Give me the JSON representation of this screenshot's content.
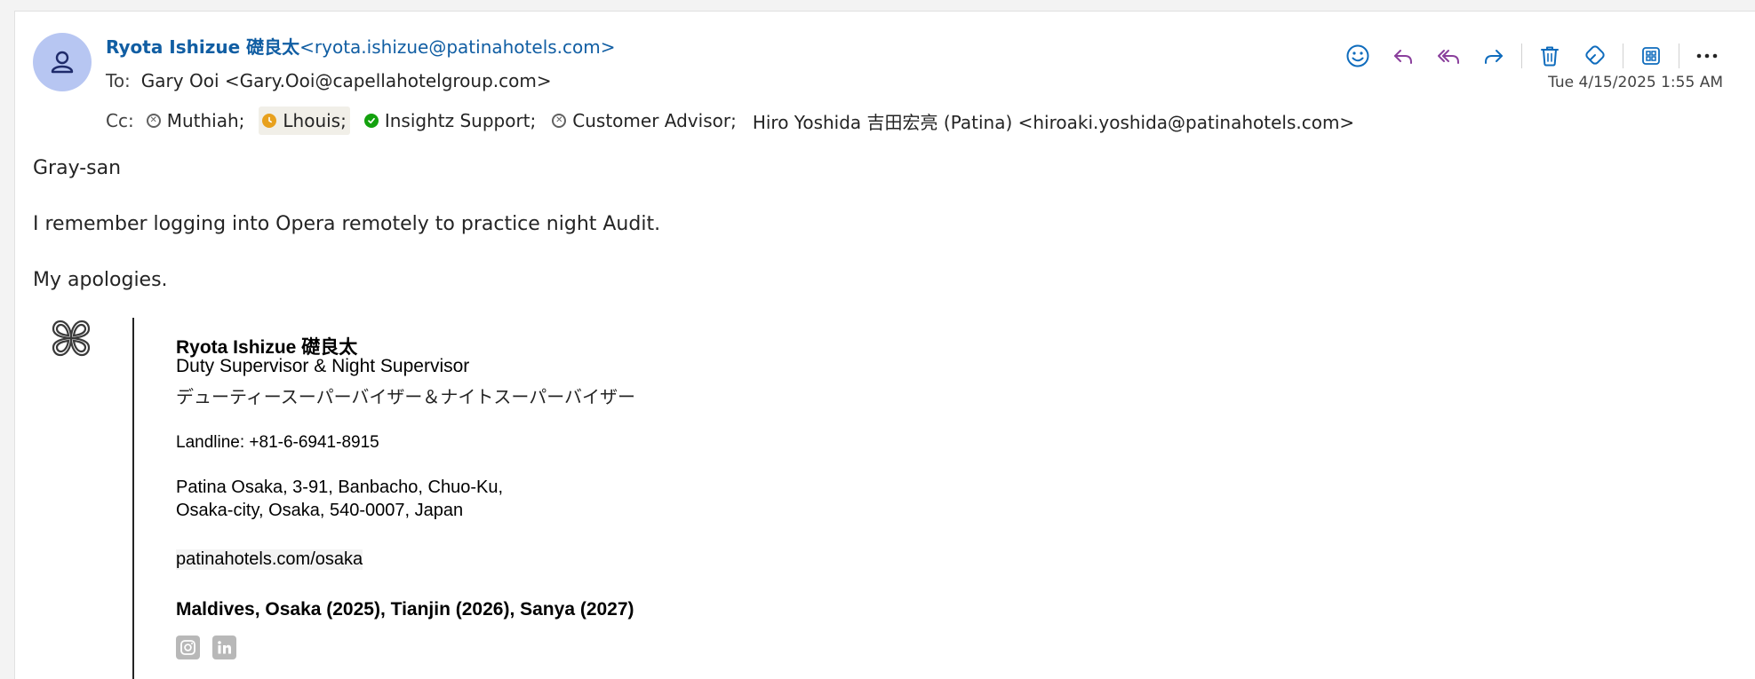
{
  "email": {
    "sender_name": "Ryota Ishizue 礎良太",
    "sender_email": "<ryota.ishizue@patinahotels.com>",
    "to_label": "To:",
    "to_value": "Gary Ooi <Gary.Ooi@capellahotelgroup.com>",
    "cc_label": "Cc:",
    "cc": [
      {
        "name": "Muthiah;",
        "status": "unknown"
      },
      {
        "name": "Lhouis;",
        "status": "away"
      },
      {
        "name": "Insightz Support;",
        "status": "available"
      },
      {
        "name": "Customer Advisor;",
        "status": "unknown"
      },
      {
        "name": "Hiro Yoshida 吉田宏亮 (Patina) <hiroaki.yoshida@patinahotels.com>",
        "status": "none"
      }
    ],
    "timestamp": "Tue 4/15/2025 1:55 AM",
    "body": {
      "greeting": "Gray-san",
      "line1": "I remember logging into Opera remotely to practice night Audit.",
      "line2": "My apologies."
    }
  },
  "toolbar": {
    "icons": [
      "emoji-icon",
      "reply-icon",
      "reply-all-icon",
      "forward-icon",
      "delete-icon",
      "sensitivity-icon",
      "apps-icon",
      "more-icon"
    ]
  },
  "signature": {
    "name": "Ryota Ishizue 礎良太",
    "title": "Duty Supervisor & Night Supervisor",
    "title_jp": "デューティースーパーバイザー＆ナイトスーパーバイザー",
    "landline": "Landline: +81-6-6941-8915",
    "address1": "Patina Osaka, 3-91, Banbacho, Chuo-Ku,",
    "address2": "Osaka-city, Osaka, 540-0007, Japan",
    "website": "patinahotels.com/osaka",
    "locations": "Maldives, Osaka (2025), Tianjin (2026), Sanya (2027)",
    "social": [
      "instagram-icon",
      "linkedin-icon"
    ]
  },
  "colors": {
    "link": "#115ea3",
    "toolbar_blue": "#0f6cbd",
    "toolbar_purple": "#8a3f9c",
    "avatar_bg": "#b7c6f2",
    "status_away": "#e8a11e",
    "status_available": "#13a10e"
  }
}
